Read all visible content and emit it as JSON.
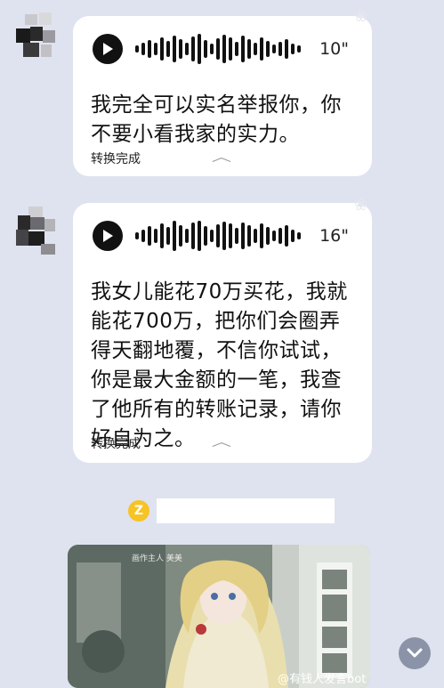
{
  "messages": [
    {
      "duration": "10\"",
      "transcript": "我完全可以实名举报你，你不要小看我家的实力。",
      "transcript_lines": [
        "我完全可以实名举报你，你",
        "不要小看我家的实力。"
      ],
      "status": "转换完成",
      "play_icon": "play-icon",
      "collapse_icon": "chevron-up-icon"
    },
    {
      "duration": "16\"",
      "transcript": "我女儿能花70万买花，我就能花700万，把你们会圈弄得天翻地覆，不信你试试，你是最大金额的一笔，我查了他所有的转账记录，请你好自为之。",
      "transcript_lines": [
        "我女儿能花70万买花，我就",
        "能花700万，把你们会圈弄",
        "得天翻地覆，不信你试试，",
        "你是最大金额的一笔，我查",
        "了他所有的转账记录，请你",
        "好自为之。"
      ],
      "status": "转换完成",
      "play_icon": "play-icon",
      "collapse_icon": "chevron-up-icon"
    }
  ],
  "third_sender": {
    "level_badge": "Z",
    "badge_color": "#f7c325",
    "image_caption": "画作主人 美美"
  },
  "watermark": "@有钱人发言bot",
  "scroll_button_icon": "chevron-down-icon",
  "colors": {
    "background": "#dfe3ef",
    "bubble": "#ffffff",
    "text": "#111111"
  }
}
